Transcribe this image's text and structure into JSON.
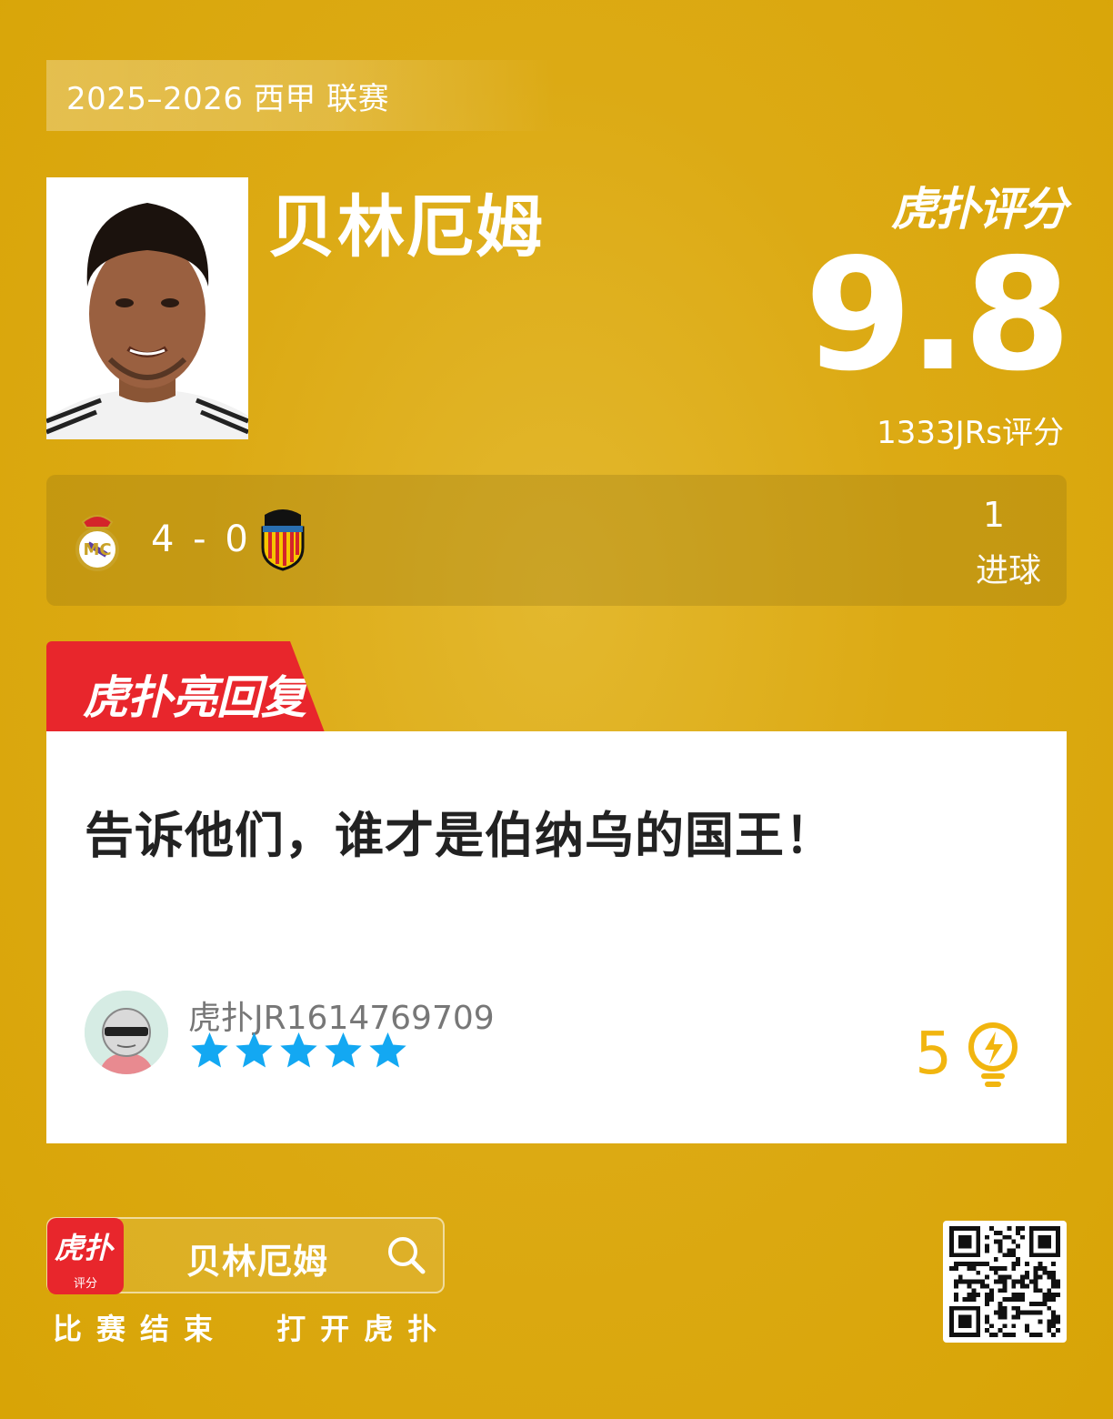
{
  "season": "2025–2026 西甲 联赛",
  "player": {
    "name": "贝林厄姆"
  },
  "rating": {
    "brand": "虎扑评分",
    "score": "9.8",
    "count": "1333JRs评分"
  },
  "match": {
    "score": "4 - 0",
    "home_crest": "real-madrid-crest",
    "away_crest": "valencia-crest",
    "stat_value": "1",
    "stat_label": "进球"
  },
  "reply": {
    "tag": "虎扑亮回复",
    "text": "告诉他们，谁才是伯纳乌的国王！",
    "username": "虎扑JR1614769709",
    "stars": 5,
    "likes": "5"
  },
  "footer": {
    "search_text": "贝林厄姆",
    "app_icon_text": "虎扑",
    "app_icon_sub": "评分",
    "cta": "比赛结束  打开虎扑"
  },
  "colors": {
    "background": "#dcaa14",
    "accent_red": "#e8262c",
    "star_blue": "#13a8f2",
    "like_gold": "#f1b50f"
  }
}
